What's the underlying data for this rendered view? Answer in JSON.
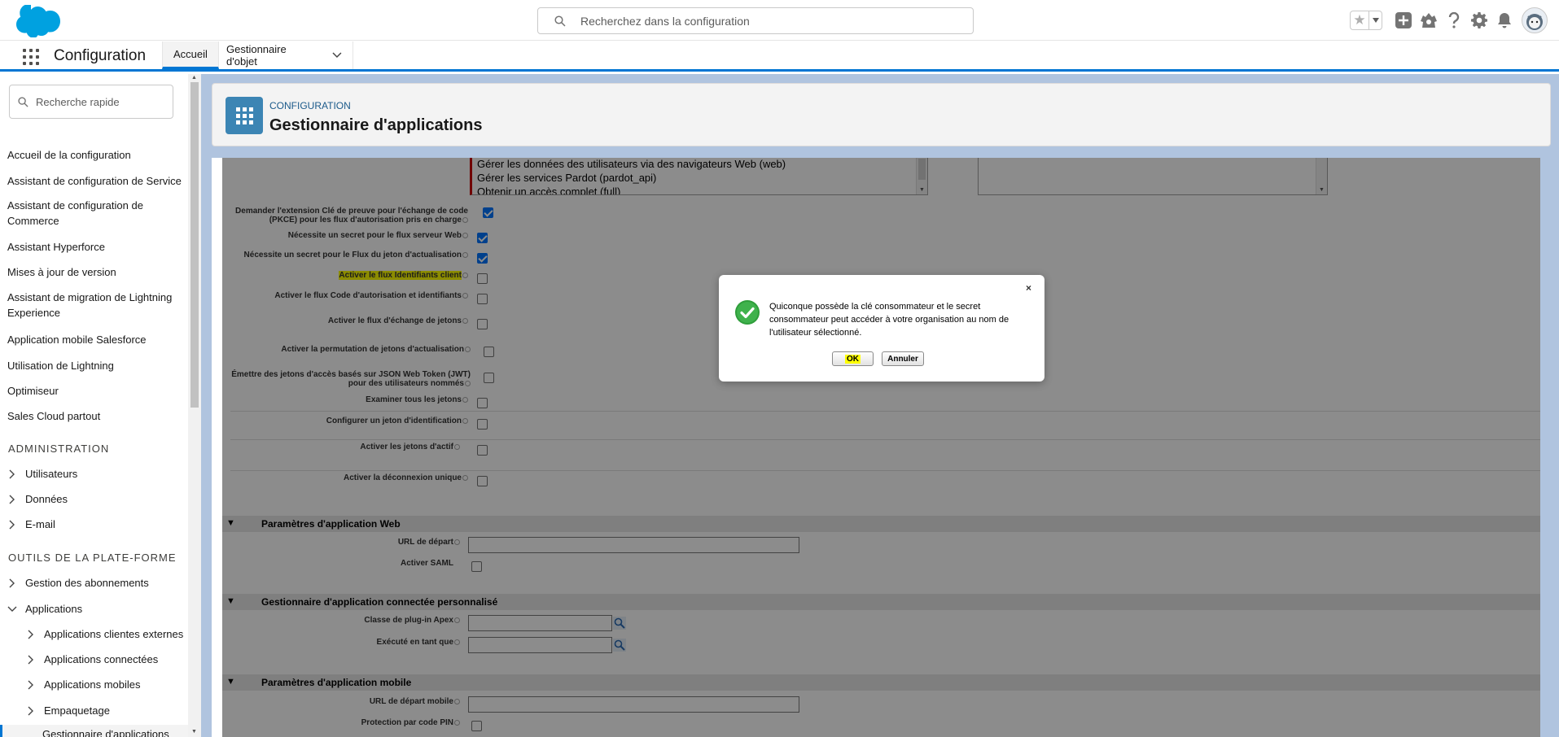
{
  "header": {
    "search_placeholder": "Recherchez dans la configuration",
    "icons": [
      "favorites-star-icon",
      "favorites-dropdown-icon",
      "global-actions-plus-icon",
      "trailhead-icon",
      "help-icon",
      "setup-gear-icon",
      "notifications-bell-icon",
      "user-avatar"
    ]
  },
  "context_bar": {
    "app_name": "Configuration",
    "tabs": [
      {
        "label": "Accueil",
        "active": true
      },
      {
        "label": "Gestionnaire d'objet",
        "active": false
      }
    ]
  },
  "sidebar": {
    "quick_find_placeholder": "Recherche rapide",
    "items": [
      "Accueil de la configuration",
      "Assistant de configuration de Service",
      "Assistant de configuration de Commerce",
      "Assistant Hyperforce",
      "Mises à jour de version",
      "Assistant de migration de Lightning Experience",
      "Application mobile Salesforce",
      "Utilisation de Lightning",
      "Optimiseur",
      "Sales Cloud partout"
    ],
    "admin_heading": "ADMINISTRATION",
    "admin_items": [
      "Utilisateurs",
      "Données",
      "E-mail"
    ],
    "platform_heading": "OUTILS DE LA PLATE-FORME",
    "platform_items": [
      "Gestion des abonnements",
      "Applications"
    ],
    "app_children": [
      "Applications clientes externes",
      "Applications connectées",
      "Applications mobiles",
      "Empaquetage",
      "Gestionnaire d'applications"
    ]
  },
  "page_header": {
    "eyebrow": "CONFIGURATION",
    "title": "Gestionnaire d'applications"
  },
  "form": {
    "scopes_selected": [
      "Gérer les données des utilisateurs via des navigateurs Web (web)",
      "Gérer les services Pardot (pardot_api)",
      "Obtenir un accès complet (full)"
    ],
    "options": [
      {
        "label": "Demander l'extension Clé de preuve pour l'échange de code (PKCE) pour les flux d'autorisation pris en charge",
        "checked": true
      },
      {
        "label": "Nécessite un secret pour le flux serveur Web",
        "checked": true
      },
      {
        "label": "Nécessite un secret pour le Flux du jeton d'actualisation",
        "checked": true
      },
      {
        "label": "Activer le flux Identifiants client",
        "checked": false
      },
      {
        "label": "Activer le flux Code d'autorisation et identifiants",
        "checked": false
      },
      {
        "label": "Activer le flux d'échange de jetons",
        "checked": false
      },
      {
        "label": "Activer la permutation de jetons d'actualisation",
        "checked": false
      },
      {
        "label": "Émettre des jetons d'accès basés sur JSON Web Token (JWT) pour des utilisateurs nommés",
        "checked": false
      },
      {
        "label": "Examiner tous les jetons",
        "checked": false
      },
      {
        "label": "Configurer un jeton d'identification",
        "checked": false
      },
      {
        "label": "Activer les jetons d'actif",
        "checked": false
      },
      {
        "label": "Activer la déconnexion unique",
        "checked": false
      }
    ],
    "web_section": {
      "title": "Paramètres d'application Web",
      "start_url_label": "URL de départ",
      "saml_label": "Activer SAML"
    },
    "custom_section": {
      "title": "Gestionnaire d'application connectée personnalisé",
      "apex_label": "Classe de plug-in Apex",
      "run_as_label": "Exécuté en tant que"
    },
    "mobile_section": {
      "title": "Paramètres d'application mobile",
      "mobile_url_label": "URL de départ mobile",
      "pin_label": "Protection par code PIN"
    }
  },
  "modal": {
    "message": "Quiconque possède la clé consommateur et le secret consommateur peut accéder à votre organisation au nom de l'utilisateur sélectionné.",
    "ok_label": "OK",
    "cancel_label": "Annuler",
    "close_label": "×"
  },
  "colors": {
    "brand": "#0176d3",
    "main_background": "#b0c4df",
    "highlight": "#ffff00"
  }
}
